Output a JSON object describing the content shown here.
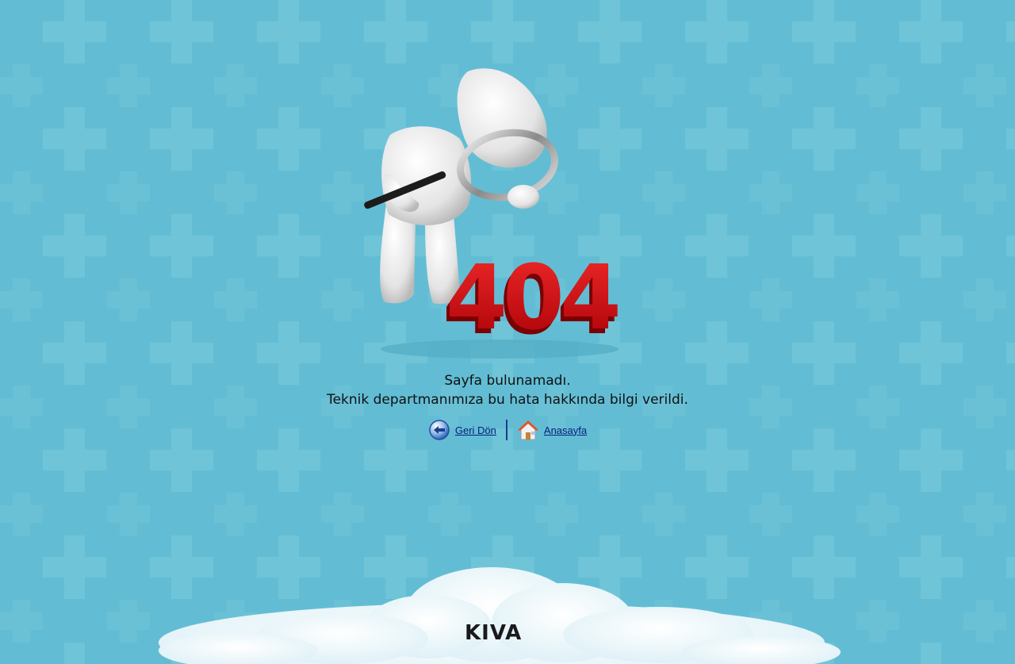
{
  "colors": {
    "background": "#62bdd4",
    "pattern_plus": "#72c6da",
    "error_code": "#d40e12",
    "link": "#0b1f7a",
    "text": "#111111"
  },
  "illustration": {
    "error_code": "404",
    "figure_icon": "person-with-magnifying-glass-icon"
  },
  "message": {
    "line1": "Sayfa bulunamadı.",
    "line2": "Teknik departmanımıza bu hata hakkında bilgi verildi."
  },
  "nav": {
    "back_label": "Geri Dön",
    "back_icon": "arrow-left-icon",
    "home_label": "Anasayfa",
    "home_icon": "home-icon"
  },
  "footer": {
    "logo": "KIVA"
  }
}
